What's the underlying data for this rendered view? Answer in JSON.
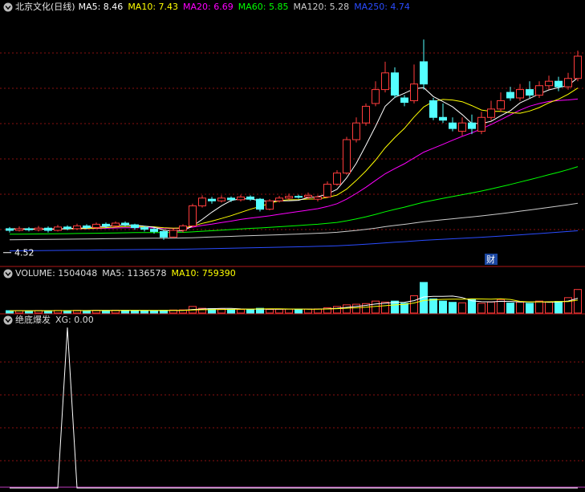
{
  "header": {
    "title": "北京文化(日线)",
    "ma_legend": [
      {
        "label": "MA5: 8.46",
        "color": "#ffffff"
      },
      {
        "label": "MA10: 7.43",
        "color": "#ffff00"
      },
      {
        "label": "MA20: 6.69",
        "color": "#ff00ff"
      },
      {
        "label": "MA60: 5.85",
        "color": "#00ff00"
      },
      {
        "label": "MA120: 5.28",
        "color": "#cccccc"
      },
      {
        "label": "MA250: 4.74",
        "color": "#2a4cff"
      }
    ]
  },
  "volume_legend": [
    {
      "label": "VOLUME: 1504048",
      "color": "#dddddd"
    },
    {
      "label": "MA5: 1136578",
      "color": "#dddddd"
    },
    {
      "label": "MA10: 759390",
      "color": "#ffff00"
    }
  ],
  "indicator_legend": [
    {
      "label": "绝底爆发",
      "color": "#dddddd"
    },
    {
      "label": "XG: 0.00",
      "color": "#dddddd"
    }
  ],
  "colors": {
    "up": "#ff3c3c",
    "down": "#54ffff",
    "grid": "#8a1010",
    "divider": "#b01818",
    "indicator_line": "#ffffff"
  },
  "price_marker": {
    "label": "4.52"
  },
  "event_marker": {
    "label": "财"
  },
  "chart_data": [
    {
      "type": "candlestick",
      "title": "北京文化(日线)",
      "ylim": [
        4.3,
        8.8
      ],
      "low_marker": 4.52,
      "candles": [
        [
          4.95,
          4.92,
          4.98,
          4.88
        ],
        [
          4.92,
          4.95,
          4.99,
          4.9
        ],
        [
          4.95,
          4.93,
          4.98,
          4.9
        ],
        [
          4.93,
          4.96,
          5.0,
          4.9
        ],
        [
          4.96,
          4.92,
          4.99,
          4.88
        ],
        [
          4.92,
          4.98,
          5.02,
          4.9
        ],
        [
          4.98,
          4.95,
          5.01,
          4.92
        ],
        [
          4.95,
          5.0,
          5.04,
          4.93
        ],
        [
          5.0,
          4.97,
          5.03,
          4.94
        ],
        [
          4.97,
          5.03,
          5.06,
          4.95
        ],
        [
          5.03,
          5.0,
          5.06,
          4.96
        ],
        [
          5.0,
          5.05,
          5.08,
          4.98
        ],
        [
          5.05,
          5.02,
          5.08,
          4.99
        ],
        [
          5.02,
          4.97,
          5.04,
          4.93
        ],
        [
          4.97,
          4.94,
          5.0,
          4.9
        ],
        [
          4.94,
          4.9,
          4.97,
          4.86
        ],
        [
          4.9,
          4.8,
          4.92,
          4.75
        ],
        [
          4.8,
          4.92,
          4.95,
          4.78
        ],
        [
          4.92,
          5.0,
          5.03,
          4.88
        ],
        [
          5.0,
          5.36,
          5.4,
          4.98
        ],
        [
          5.36,
          5.5,
          5.55,
          5.33
        ],
        [
          5.48,
          5.45,
          5.52,
          5.4
        ],
        [
          5.45,
          5.5,
          5.55,
          5.42
        ],
        [
          5.5,
          5.47,
          5.53,
          5.43
        ],
        [
          5.47,
          5.52,
          5.56,
          5.44
        ],
        [
          5.52,
          5.48,
          5.55,
          5.45
        ],
        [
          5.48,
          5.3,
          5.5,
          5.26
        ],
        [
          5.3,
          5.45,
          5.48,
          5.28
        ],
        [
          5.45,
          5.5,
          5.54,
          5.42
        ],
        [
          5.5,
          5.53,
          5.58,
          5.47
        ],
        [
          5.53,
          5.52,
          5.56,
          5.49
        ],
        [
          5.52,
          5.55,
          5.6,
          5.48
        ],
        [
          5.48,
          5.52,
          5.55,
          5.44
        ],
        [
          5.52,
          5.75,
          5.8,
          5.5
        ],
        [
          5.75,
          5.95,
          6.0,
          5.72
        ],
        [
          5.95,
          6.55,
          6.6,
          5.92
        ],
        [
          6.55,
          6.85,
          6.95,
          6.5
        ],
        [
          6.85,
          7.15,
          7.2,
          6.8
        ],
        [
          7.2,
          7.45,
          7.6,
          7.15
        ],
        [
          7.45,
          7.75,
          7.95,
          7.4
        ],
        [
          7.75,
          7.35,
          7.85,
          7.3
        ],
        [
          7.3,
          7.22,
          7.35,
          7.15
        ],
        [
          7.25,
          7.55,
          7.9,
          7.2
        ],
        [
          7.95,
          7.55,
          8.35,
          7.45
        ],
        [
          7.25,
          6.95,
          7.3,
          6.9
        ],
        [
          6.95,
          6.9,
          7.2,
          6.85
        ],
        [
          6.85,
          6.75,
          6.95,
          6.7
        ],
        [
          6.7,
          6.85,
          6.95,
          6.62
        ],
        [
          6.85,
          6.75,
          7.0,
          6.65
        ],
        [
          6.7,
          6.95,
          7.05,
          6.65
        ],
        [
          6.95,
          7.1,
          7.25,
          6.9
        ],
        [
          7.1,
          7.25,
          7.4,
          7.05
        ],
        [
          7.4,
          7.3,
          7.5,
          7.25
        ],
        [
          7.3,
          7.45,
          7.55,
          7.25
        ],
        [
          7.45,
          7.35,
          7.6,
          7.3
        ],
        [
          7.35,
          7.52,
          7.6,
          7.3
        ],
        [
          7.52,
          7.6,
          7.7,
          7.45
        ],
        [
          7.6,
          7.5,
          7.68,
          7.42
        ],
        [
          7.5,
          7.65,
          7.75,
          7.45
        ],
        [
          7.65,
          8.05,
          8.15,
          7.6
        ]
      ]
    },
    {
      "type": "bar",
      "title": "VOLUME",
      "values": [
        150,
        155,
        140,
        160,
        150,
        165,
        155,
        170,
        150,
        175,
        160,
        180,
        170,
        160,
        150,
        145,
        170,
        190,
        200,
        420,
        300,
        280,
        250,
        240,
        230,
        225,
        300,
        230,
        240,
        250,
        245,
        255,
        260,
        340,
        420,
        520,
        560,
        600,
        760,
        700,
        760,
        620,
        1100,
        1950,
        900,
        760,
        680,
        650,
        900,
        620,
        700,
        860,
        640,
        700,
        620,
        760,
        720,
        740,
        980,
        1500
      ]
    },
    {
      "type": "line",
      "title": "绝底爆发",
      "series": [
        {
          "name": "XG",
          "values": [
            0,
            0,
            0,
            0,
            0,
            0,
            1,
            0,
            0,
            0,
            0,
            0,
            0,
            0,
            0,
            0,
            0,
            0,
            0,
            0,
            0,
            0,
            0,
            0,
            0,
            0,
            0,
            0,
            0,
            0,
            0,
            0,
            0,
            0,
            0,
            0,
            0,
            0,
            0,
            0,
            0,
            0,
            0,
            0,
            0,
            0,
            0,
            0,
            0,
            0,
            0,
            0,
            0,
            0,
            0,
            0,
            0,
            0,
            0,
            0
          ]
        }
      ],
      "ylim": [
        0,
        1
      ]
    }
  ]
}
